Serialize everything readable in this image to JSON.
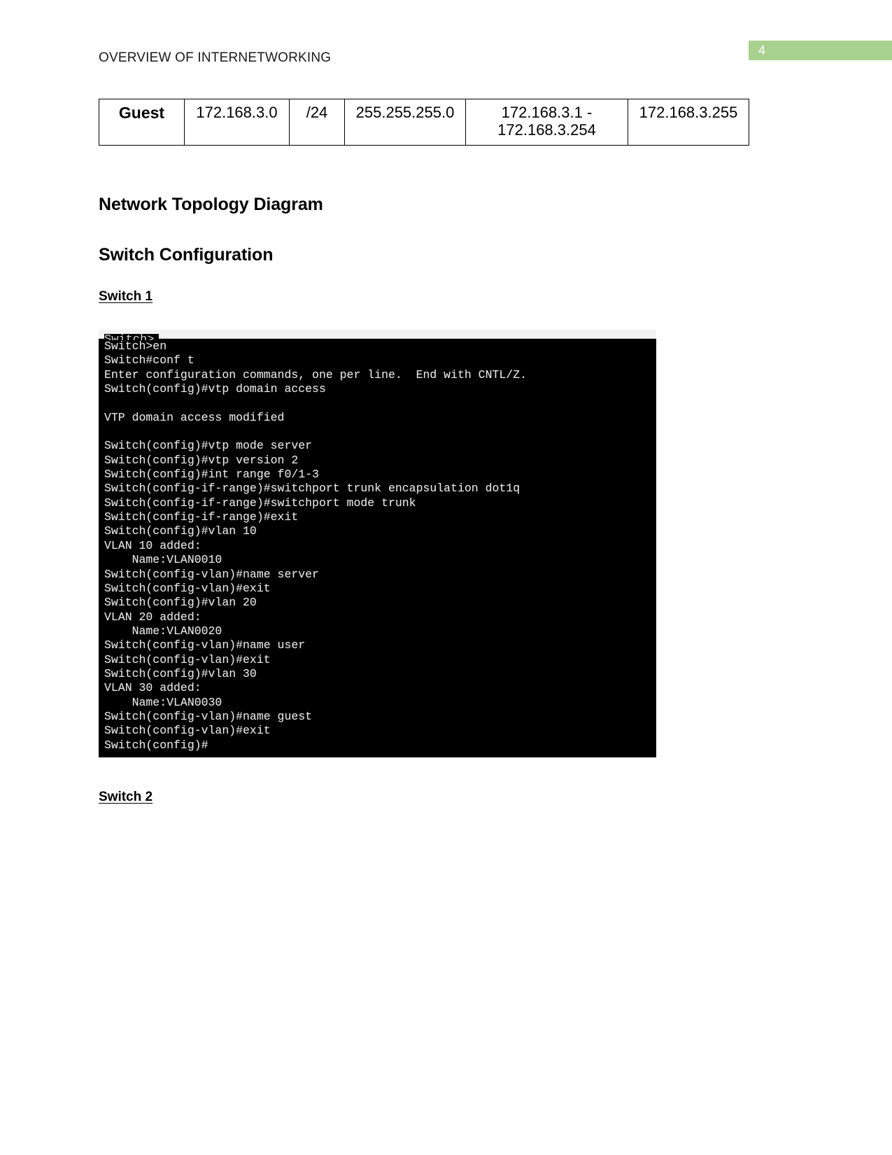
{
  "page": {
    "number": "4",
    "badge_color": "#a9d18e",
    "header_text": "OVERVIEW OF INTERNETWORKING"
  },
  "subnet_table": {
    "row": {
      "name": "Guest",
      "network": "172.168.3.0",
      "cidr": "/24",
      "mask": "255.255.255.0",
      "host_range": "172.168.3.1 - 172.168.3.254",
      "broadcast": "172.168.3.255"
    }
  },
  "headings": {
    "topology": "Network Topology Diagram",
    "switch_configuration": "Switch Configuration",
    "switch_1": "Switch 1",
    "switch_2": "Switch 2"
  },
  "terminal": {
    "clipped_top_line": "Switch>",
    "lines": [
      "Switch>en",
      "Switch#conf t",
      "Enter configuration commands, one per line.  End with CNTL/Z.",
      "Switch(config)#vtp domain access",
      "",
      "VTP domain access modified",
      "",
      "Switch(config)#vtp mode server",
      "Switch(config)#vtp version 2",
      "Switch(config)#int range f0/1-3",
      "Switch(config-if-range)#switchport trunk encapsulation dot1q",
      "Switch(config-if-range)#switchport mode trunk",
      "Switch(config-if-range)#exit",
      "Switch(config)#vlan 10",
      "VLAN 10 added:",
      "    Name:VLAN0010",
      "Switch(config-vlan)#name server",
      "Switch(config-vlan)#exit",
      "Switch(config)#vlan 20",
      "VLAN 20 added:",
      "    Name:VLAN0020",
      "Switch(config-vlan)#name user",
      "Switch(config-vlan)#exit",
      "Switch(config)#vlan 30",
      "VLAN 30 added:",
      "    Name:VLAN0030",
      "Switch(config-vlan)#name guest",
      "Switch(config-vlan)#exit",
      "Switch(config)#"
    ]
  }
}
